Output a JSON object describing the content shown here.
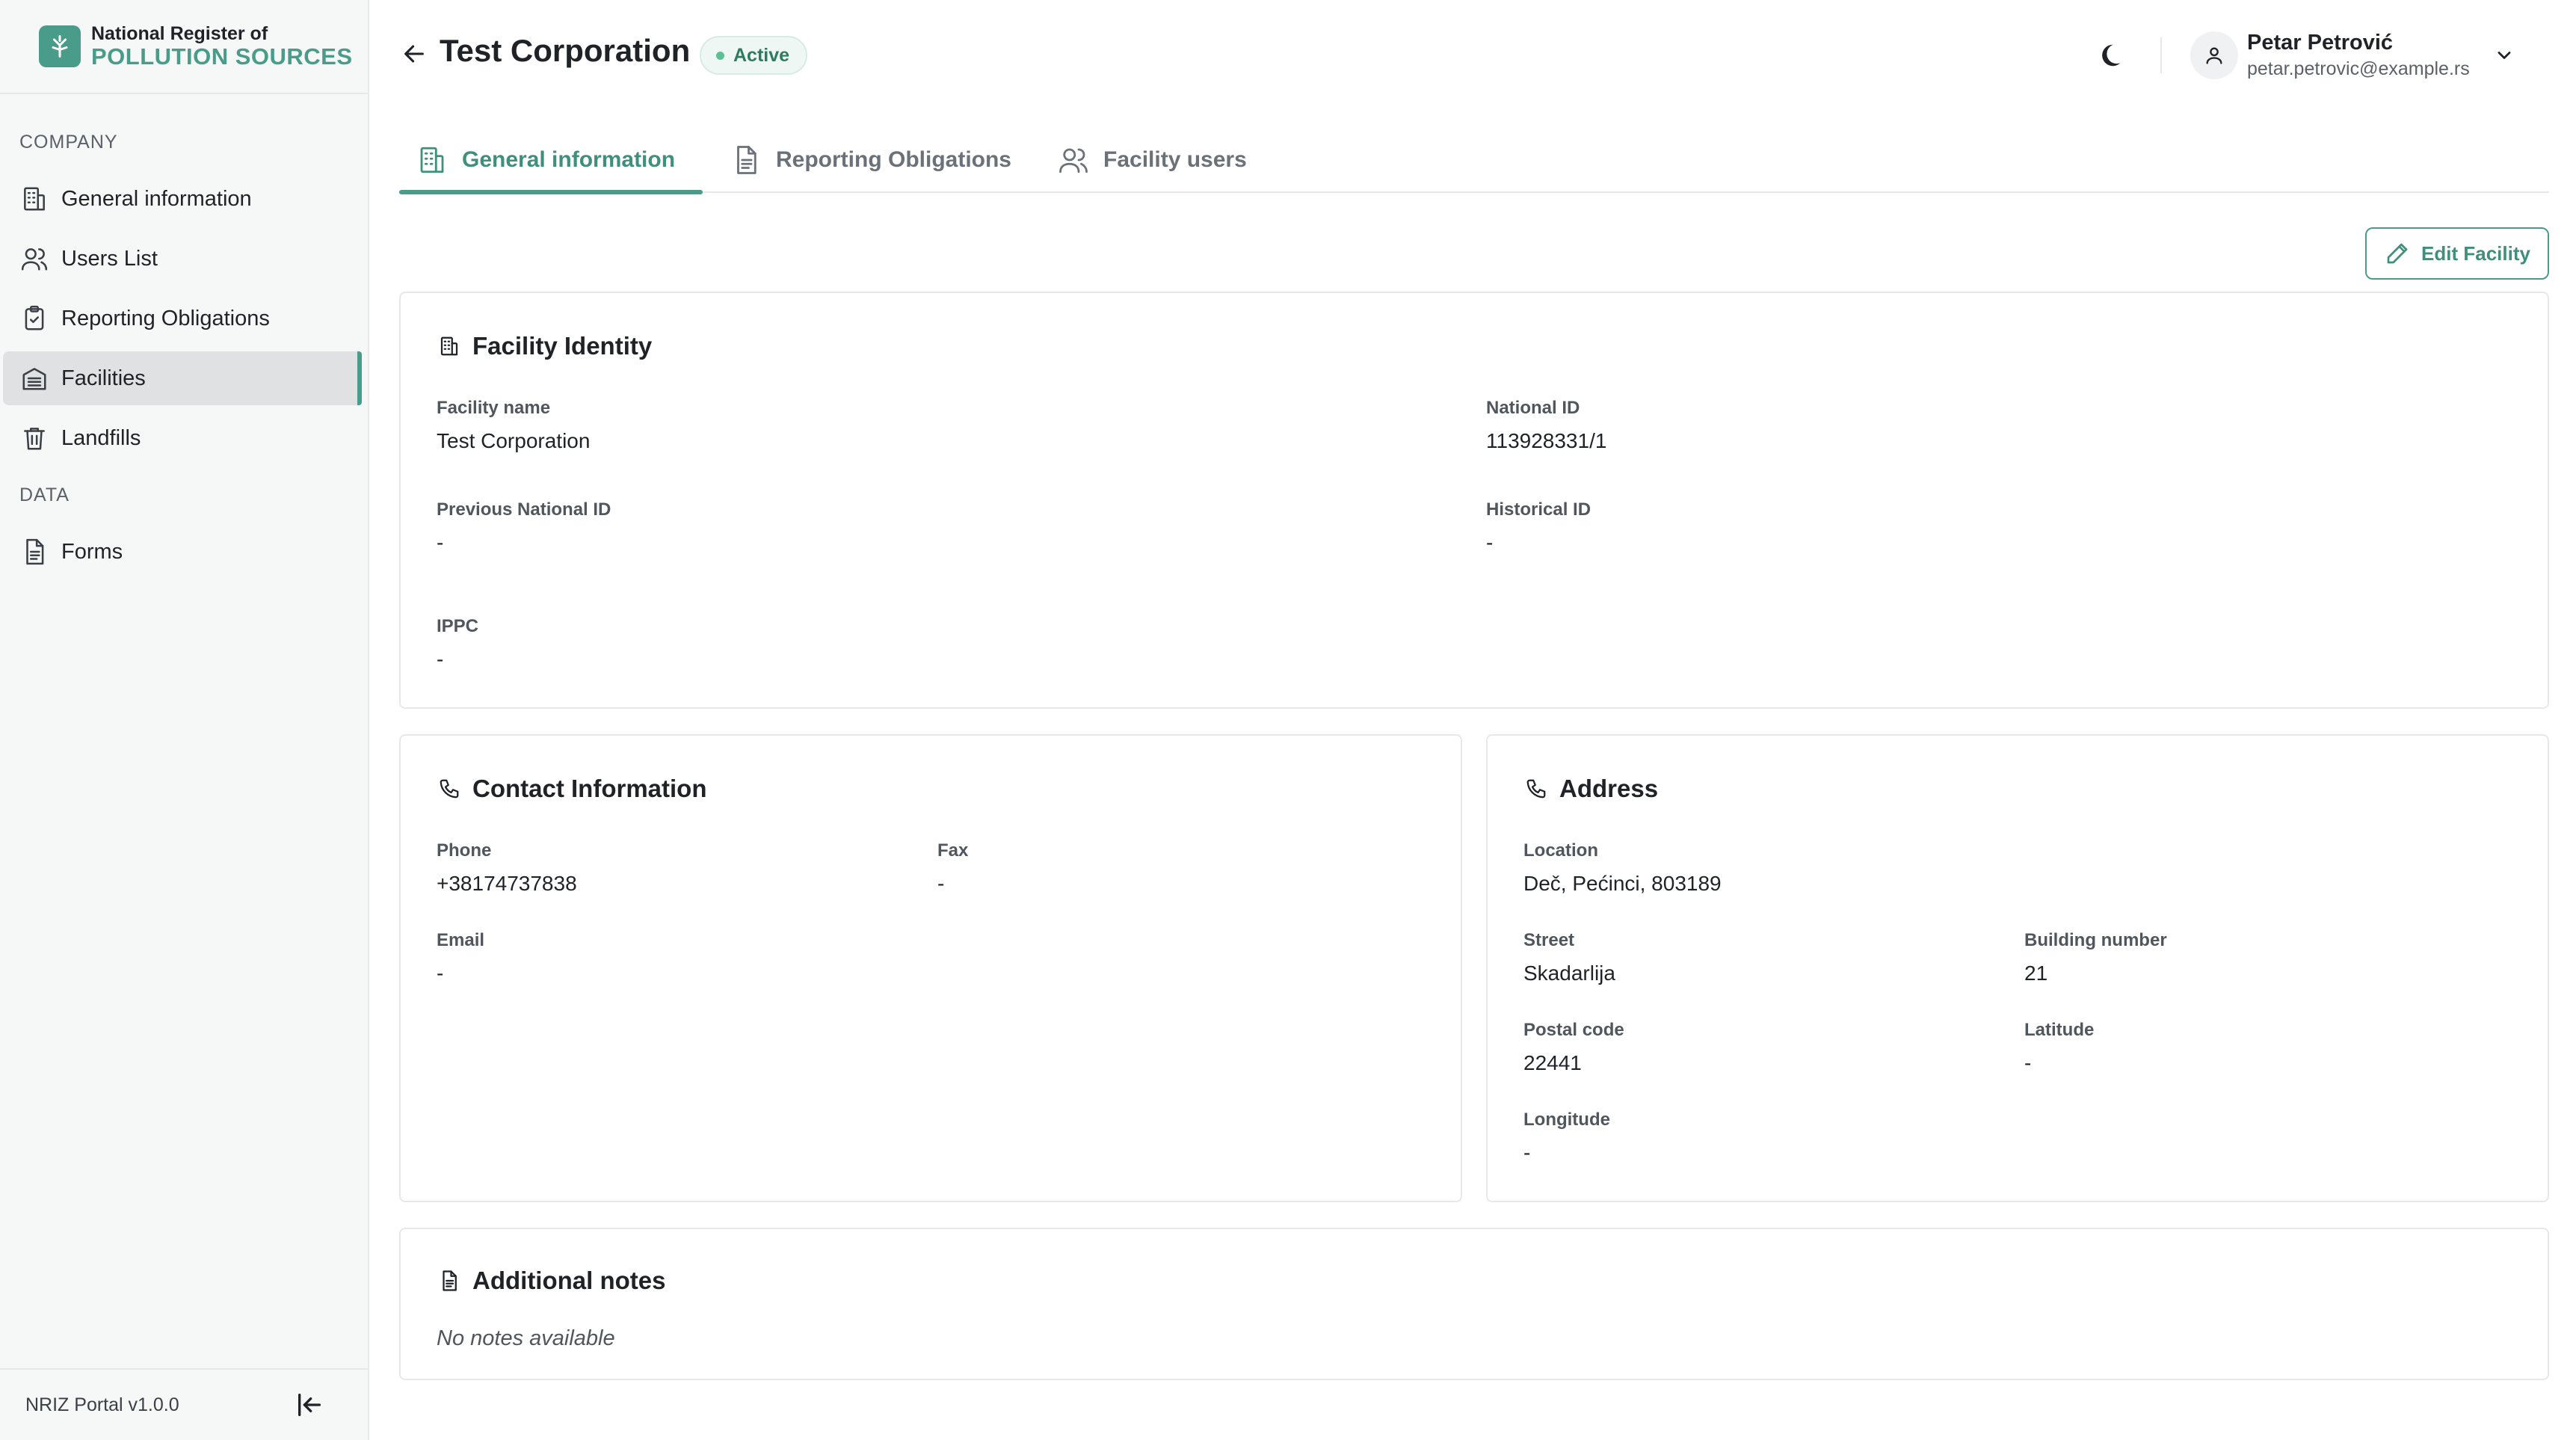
{
  "brand": {
    "line1": "National Register of",
    "line2": "POLLUTION SOURCES",
    "color": "#4a9c8a"
  },
  "sidebar": {
    "section_company": "COMPANY",
    "section_data": "DATA",
    "items": [
      {
        "label": "General information",
        "icon": "building-icon"
      },
      {
        "label": "Users List",
        "icon": "users-icon"
      },
      {
        "label": "Reporting Obligations",
        "icon": "clipboard-check-icon"
      },
      {
        "label": "Facilities",
        "icon": "facility-icon",
        "active": true
      },
      {
        "label": "Landfills",
        "icon": "trash-icon"
      }
    ],
    "data_items": [
      {
        "label": "Forms",
        "icon": "document-icon"
      }
    ],
    "version": "NRIZ Portal v1.0.0"
  },
  "header": {
    "title": "Test Corporation",
    "status": "Active",
    "status_color": "#5fbf94"
  },
  "user": {
    "name": "Petar Petrović",
    "email": "petar.petrovic@example.rs"
  },
  "tabs": [
    {
      "label": "General information",
      "icon": "building-icon",
      "active": true
    },
    {
      "label": "Reporting Obligations",
      "icon": "document-icon"
    },
    {
      "label": "Facility users",
      "icon": "users-icon"
    }
  ],
  "actions": {
    "edit_label": "Edit Facility"
  },
  "identity": {
    "title": "Facility Identity",
    "facility_name_label": "Facility name",
    "facility_name": "Test Corporation",
    "national_id_label": "National ID",
    "national_id": "113928331/1",
    "previous_id_label": "Previous National ID",
    "previous_id": "-",
    "historical_id_label": "Historical ID",
    "historical_id": "-",
    "ippc_label": "IPPC",
    "ippc": "-"
  },
  "contact": {
    "title": "Contact Information",
    "phone_label": "Phone",
    "phone": "+38174737838",
    "fax_label": "Fax",
    "fax": "-",
    "email_label": "Email",
    "email": "-"
  },
  "address": {
    "title": "Address",
    "location_label": "Location",
    "location": "Deč, Pećinci, 803189",
    "street_label": "Street",
    "street": "Skadarlija",
    "building_label": "Building number",
    "building": "21",
    "postal_label": "Postal code",
    "postal": "22441",
    "latitude_label": "Latitude",
    "latitude": "-",
    "longitude_label": "Longitude",
    "longitude": "-"
  },
  "notes": {
    "title": "Additional notes",
    "text": "No notes available"
  }
}
